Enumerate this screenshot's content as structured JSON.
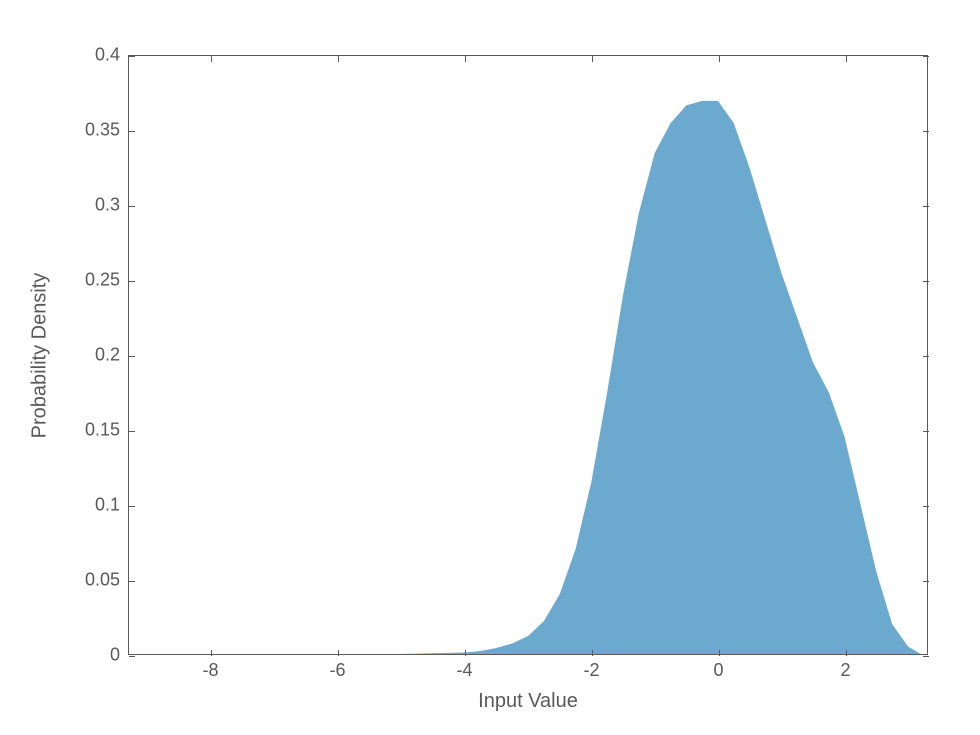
{
  "chart_data": {
    "type": "area",
    "title": "",
    "xlabel": "Input Value",
    "ylabel": "Probability Density",
    "xlim": [
      -9.3,
      3.3
    ],
    "ylim": [
      0,
      0.4
    ],
    "x_ticks": [
      -8,
      -6,
      -4,
      -2,
      0,
      2
    ],
    "y_ticks": [
      0,
      0.05,
      0.1,
      0.15,
      0.2,
      0.25,
      0.3,
      0.35,
      0.4
    ],
    "fill_color": "#6ca9cf",
    "x": [
      -5.0,
      -4.5,
      -4.0,
      -3.75,
      -3.5,
      -3.25,
      -3.0,
      -2.75,
      -2.5,
      -2.25,
      -2.0,
      -1.75,
      -1.5,
      -1.25,
      -1.0,
      -0.75,
      -0.5,
      -0.25,
      0.0,
      0.25,
      0.5,
      0.75,
      1.0,
      1.25,
      1.5,
      1.75,
      2.0,
      2.25,
      2.5,
      2.75,
      3.0,
      3.2
    ],
    "values": [
      0.0,
      0.0005,
      0.001,
      0.002,
      0.004,
      0.007,
      0.012,
      0.022,
      0.04,
      0.07,
      0.115,
      0.175,
      0.24,
      0.295,
      0.335,
      0.355,
      0.367,
      0.37,
      0.37,
      0.355,
      0.325,
      0.29,
      0.255,
      0.225,
      0.195,
      0.175,
      0.145,
      0.1,
      0.055,
      0.02,
      0.005,
      0.0
    ]
  }
}
